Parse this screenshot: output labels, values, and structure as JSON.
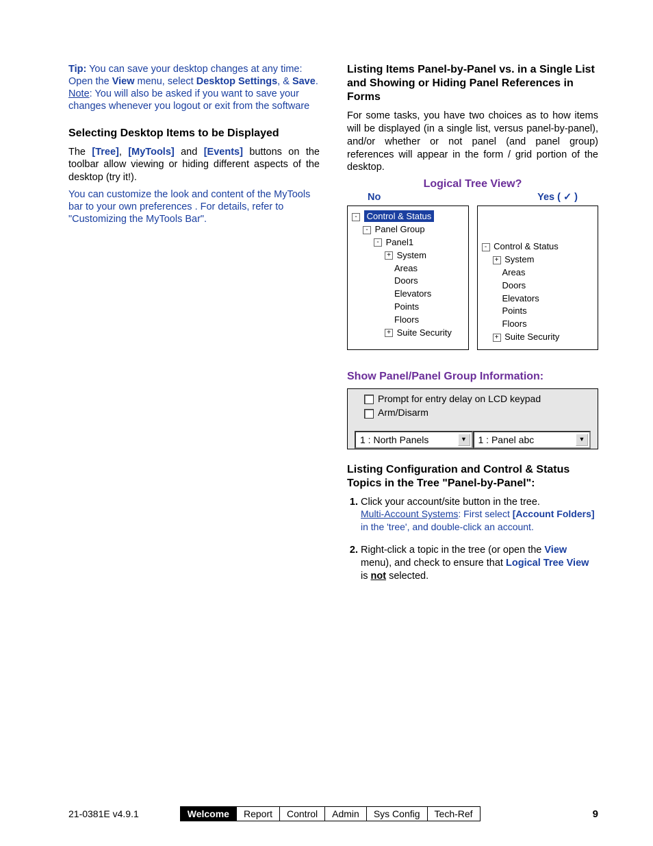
{
  "left": {
    "tip_label": "Tip:",
    "tip_line1": "  You can save your desktop changes at any time: Open the ",
    "tip_view": "View",
    "tip_line2": " menu, select ",
    "tip_desktop": "Desktop Settings",
    "tip_line3": ", & ",
    "tip_save": "Save",
    "tip_line4": ".  ",
    "tip_note": "Note",
    "tip_line5": ":  You will also be asked if you want to save your changes whenever you logout or exit from the software",
    "h_select": "Selecting Desktop Items to be Displayed",
    "p1a": "The ",
    "tree": "[Tree]",
    "p1b": ", ",
    "mytools": "[MyTools]",
    "p1c": " and ",
    "events": "[Events]",
    "p1d": " buttons on the toolbar allow viewing or hiding different aspects of the desktop (try it!).",
    "blue2": "You can customize the look and content of the MyTools bar to your own preferences .  For details, refer to \"Customizing the MyTools Bar\"."
  },
  "right": {
    "h1": "Listing Items Panel-by-Panel vs. in a Single List and Showing or Hiding Panel References in Forms",
    "p1": "For some tasks, you have two choices as to how items will be displayed (in a single list, versus panel-by-panel), and/or whether or not panel (and panel group) references will appear in the form / grid portion of the desktop.",
    "logical_q": "Logical Tree View?",
    "no": "No",
    "yes": "Yes ( ✓ )",
    "tree_no": {
      "root": "Control & Status",
      "pg": "Panel Group",
      "p1": "Panel1",
      "sys": "System",
      "areas": "Areas",
      "doors": "Doors",
      "elev": "Elevators",
      "pts": "Points",
      "floors": "Floors",
      "suite": "Suite Security"
    },
    "tree_yes": {
      "root": "Control & Status",
      "sys": "System",
      "areas": "Areas",
      "doors": "Doors",
      "elev": "Elevators",
      "pts": "Points",
      "floors": "Floors",
      "suite": "Suite Security"
    },
    "h_show": "Show Panel/Panel Group Information:",
    "chk1": "Prompt for entry delay on LCD keypad",
    "chk2": "Arm/Disarm",
    "dd1": "1 : North Panels",
    "dd2": "1 : Panel abc",
    "h_listing": "Listing Configuration and Control & Status Topics in the Tree \"Panel-by-Panel\":",
    "step1": "Click your account/site button in the tree.",
    "step1_sub_a": "Multi-Account Systems",
    "step1_sub_b": ":  First select ",
    "step1_sub_c": "[Account Folders]",
    "step1_sub_d": " in the 'tree', and double-click an account.",
    "step2a": "Right-click a topic in the tree (or open the ",
    "step2_view": "View",
    "step2b": " menu), and check to ensure that ",
    "step2_ltv": "Logical Tree View",
    "step2c": " is ",
    "step2_not": "not",
    "step2d": " selected."
  },
  "footer": {
    "docid": "21-0381E v4.9.1",
    "tabs": [
      "Welcome",
      "Report",
      "Control",
      "Admin",
      "Sys Config",
      "Tech-Ref"
    ],
    "page": "9"
  }
}
